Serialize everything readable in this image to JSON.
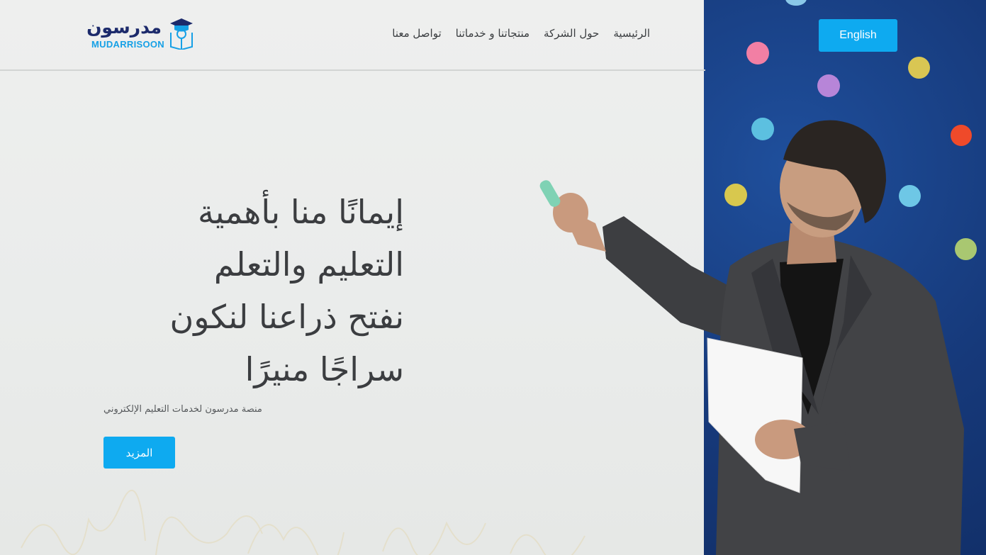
{
  "brand": {
    "name_ar": "مدرسون",
    "name_en": "MUDARRISOON"
  },
  "nav": {
    "items": [
      {
        "label": "الرئيسية"
      },
      {
        "label": "حول الشركة"
      },
      {
        "label": "منتجاتنا و خدماتنا"
      },
      {
        "label": "تواصل معنا"
      }
    ]
  },
  "language_button": {
    "label": "English"
  },
  "hero": {
    "title_lines": [
      "إيمانًا منا بأهمية",
      "التعليم والتعلم",
      "نفتح ذراعنا لنكون",
      "سراجًا منيرًا"
    ],
    "subtitle": "منصة مدرسون لخدمات التعليم الإلكتروني",
    "cta_label": "المزيد"
  },
  "colors": {
    "accent": "#0eaaf0",
    "brand_dark": "#1c2a6b",
    "wall_blue": "#16397a"
  },
  "icons": {
    "logo": "graduation-cap-book-icon"
  }
}
